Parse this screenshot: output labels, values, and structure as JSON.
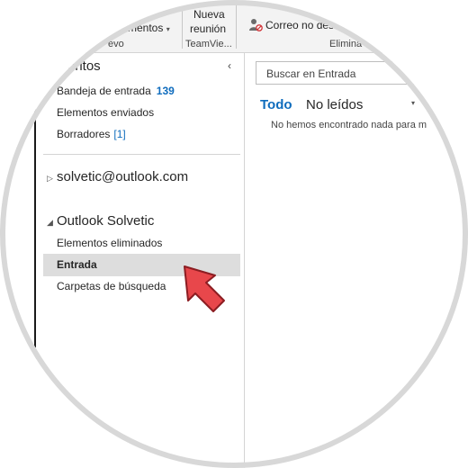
{
  "ribbon": {
    "items_label": "mentos",
    "new_meeting_line1": "Nueva",
    "new_meeting_line2": "reunión",
    "group_new": "evo",
    "group_teamviewer": "TeamVie...",
    "junk_label": "Correo no des",
    "group_delete": "Elimina"
  },
  "favorites": {
    "header": "oritos",
    "items": [
      {
        "label": "Bandeja de entrada",
        "count": "139"
      },
      {
        "label": "Elementos enviados"
      },
      {
        "label": "Borradores",
        "count": "[1]"
      }
    ]
  },
  "accounts": [
    {
      "name": "solvetic@outlook.com"
    },
    {
      "name": "Outlook Solvetic",
      "folders": [
        "Elementos eliminados",
        "Entrada",
        "Carpetas de búsqueda"
      ]
    }
  ],
  "message_pane": {
    "search_placeholder": "Buscar en Entrada",
    "tab_all": "Todo",
    "tab_unread": "No leídos",
    "empty_text": "No hemos encontrado nada para m"
  },
  "colors": {
    "accent": "#0f6cbd",
    "selection": "#dddddd",
    "arrow": "#e8474b"
  }
}
